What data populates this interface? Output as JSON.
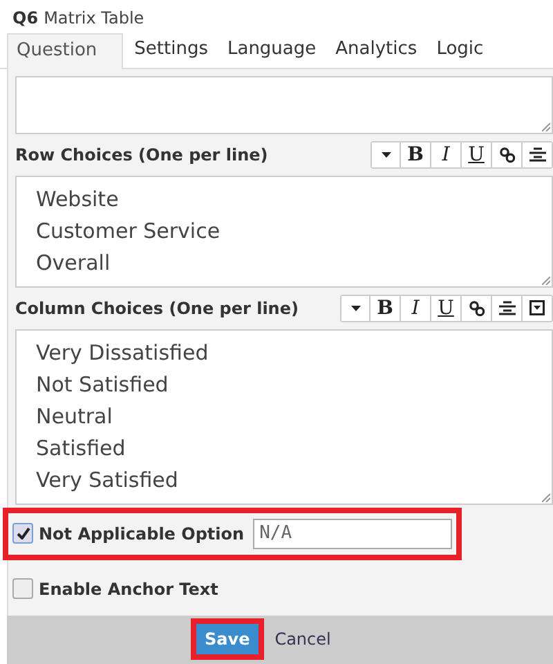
{
  "title": {
    "number": "Q6",
    "name": "Matrix Table"
  },
  "tabs": [
    {
      "label": "Question",
      "selected": true
    },
    {
      "label": "Settings",
      "selected": false
    },
    {
      "label": "Language",
      "selected": false
    },
    {
      "label": "Analytics",
      "selected": false
    },
    {
      "label": "Logic",
      "selected": false
    }
  ],
  "sections": [
    {
      "label": "Row Choices (One per line)",
      "toolbar": [
        {
          "kind": "caret"
        },
        {
          "kind": "bold",
          "label": "B"
        },
        {
          "kind": "italic",
          "label": "I"
        },
        {
          "kind": "underline",
          "label": "U"
        },
        {
          "kind": "link"
        },
        {
          "kind": "align"
        }
      ],
      "lines": [
        "Website",
        "Customer Service",
        "Overall"
      ]
    },
    {
      "label": "Column Choices (One per line)",
      "toolbar": [
        {
          "kind": "caret"
        },
        {
          "kind": "bold",
          "label": "B"
        },
        {
          "kind": "italic",
          "label": "I"
        },
        {
          "kind": "underline",
          "label": "U"
        },
        {
          "kind": "link"
        },
        {
          "kind": "align"
        },
        {
          "kind": "dropdown"
        }
      ],
      "lines": [
        "Very Dissatisfied",
        "Not Satisfied",
        "Neutral",
        "Satisfied",
        "Very Satisfied"
      ]
    }
  ],
  "options": [
    {
      "label": "Not Applicable Option",
      "checked": true,
      "value": "N/A",
      "highlighted": true
    },
    {
      "label": "Enable Anchor Text",
      "checked": false,
      "highlighted": false
    }
  ],
  "footer": {
    "save": {
      "label": "Save",
      "highlighted": true
    },
    "cancel": {
      "label": "Cancel"
    }
  }
}
